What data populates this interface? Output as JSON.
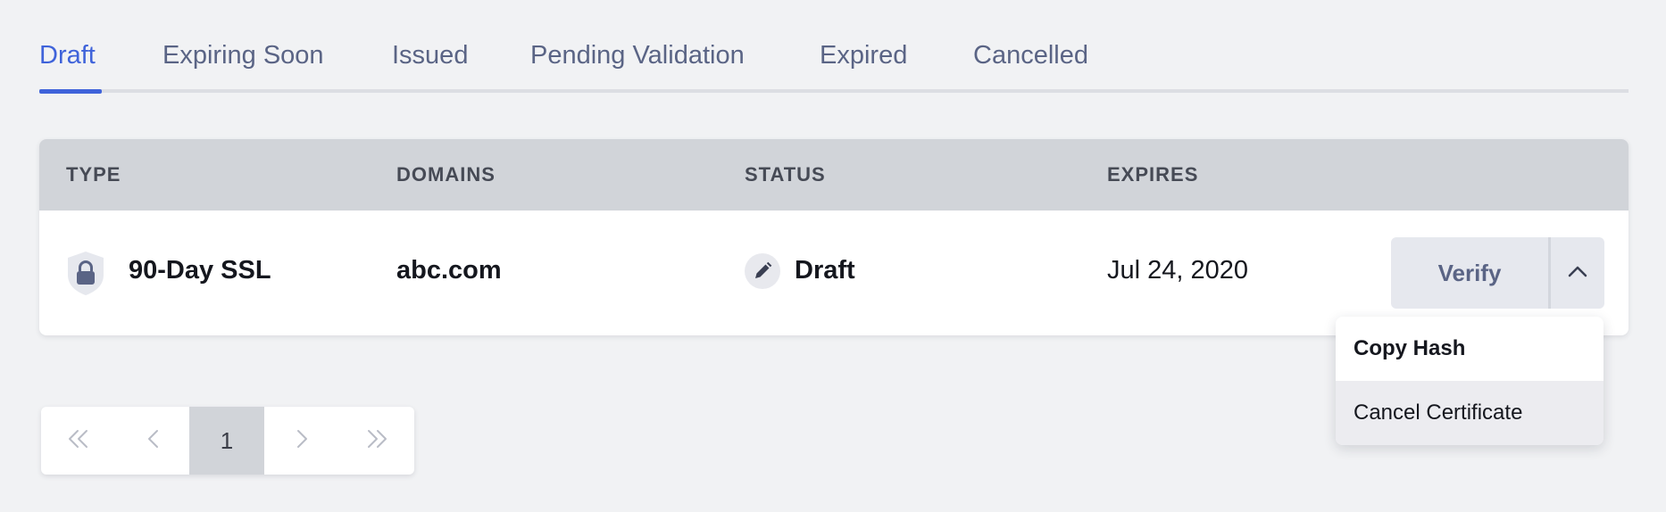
{
  "tabs": [
    {
      "label": "Draft",
      "active": true
    },
    {
      "label": "Expiring Soon",
      "active": false
    },
    {
      "label": "Issued",
      "active": false
    },
    {
      "label": "Pending Validation",
      "active": false
    },
    {
      "label": "Expired",
      "active": false
    },
    {
      "label": "Cancelled",
      "active": false
    }
  ],
  "table": {
    "headers": [
      "TYPE",
      "DOMAINS",
      "STATUS",
      "EXPIRES"
    ],
    "rows": [
      {
        "type": "90-Day SSL",
        "type_icon": "lock-shield-icon",
        "domain": "abc.com",
        "status": "Draft",
        "status_icon": "pencil-icon",
        "expires": "Jul 24, 2020",
        "action_label": "Verify",
        "toggle_icon": "chevron-up-icon"
      }
    ]
  },
  "dropdown": {
    "items": [
      "Copy Hash",
      "Cancel Certificate"
    ]
  },
  "pagination": {
    "first_icon": "double-chevron-left-icon",
    "prev_icon": "chevron-left-icon",
    "current_page": "1",
    "next_icon": "chevron-right-icon",
    "last_icon": "double-chevron-right-icon"
  },
  "colors": {
    "accent": "#3f63da",
    "tab_text": "#5a6485",
    "header_bg": "#d1d4d9",
    "page_bg": "#f1f2f4"
  }
}
